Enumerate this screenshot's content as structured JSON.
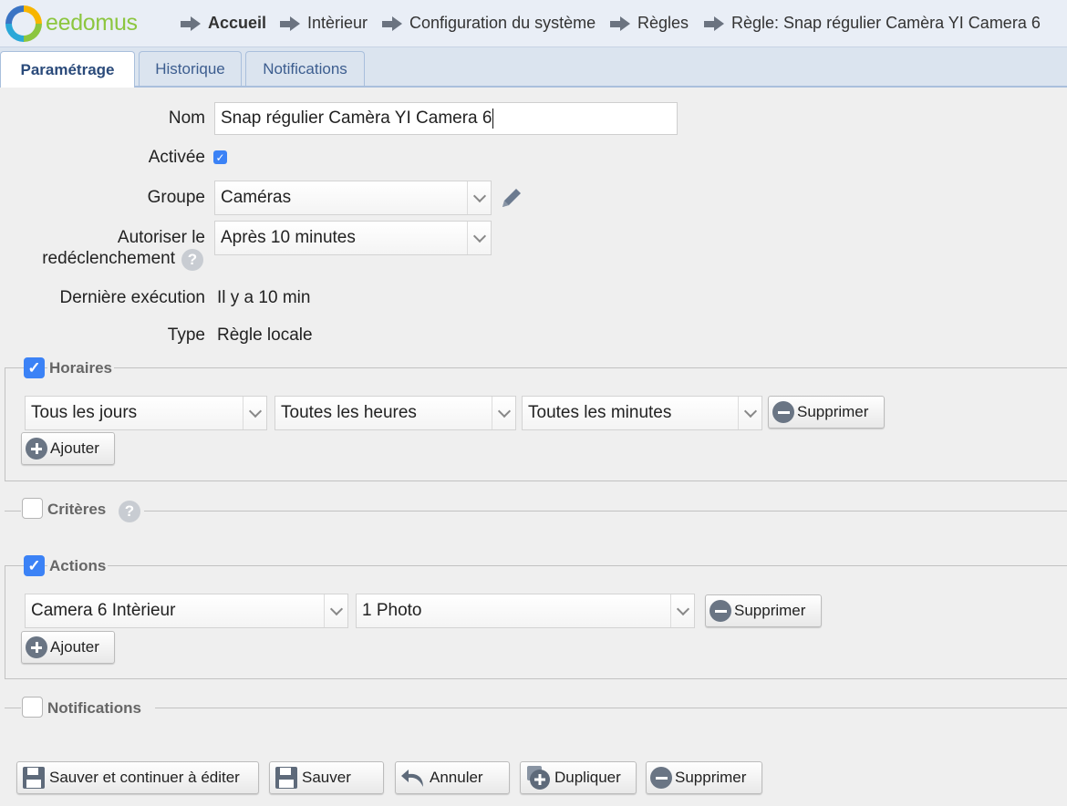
{
  "app": {
    "logo_text": "eedomus"
  },
  "breadcrumb": [
    "Accueil",
    "Intèrieur",
    "Configuration du système",
    "Règles",
    "Règle: Snap régulier Camèra YI Camera 6"
  ],
  "tabs": [
    {
      "label": "Paramétrage",
      "active": true
    },
    {
      "label": "Historique",
      "active": false
    },
    {
      "label": "Notifications",
      "active": false
    }
  ],
  "form": {
    "nom_label": "Nom",
    "nom_value": "Snap régulier Camèra YI Camera 6",
    "activee_label": "Activée",
    "activee_checked": true,
    "groupe_label": "Groupe",
    "groupe_value": "Caméras",
    "autoriser_label_1": "Autoriser le",
    "autoriser_label_2": "redéclenchement",
    "autoriser_value": "Après 10 minutes",
    "derniere_label": "Dernière exécution",
    "derniere_value": "Il y a 10 min",
    "type_label": "Type",
    "type_value": "Règle locale"
  },
  "horaires": {
    "legend": "Horaires",
    "checked": true,
    "jours": "Tous les jours",
    "heures": "Toutes les heures",
    "minutes": "Toutes les minutes",
    "supprimer": "Supprimer",
    "ajouter": "Ajouter"
  },
  "criteres": {
    "legend": "Critères",
    "checked": false
  },
  "actions": {
    "legend": "Actions",
    "checked": true,
    "device": "Camera 6 Intèrieur",
    "value": "1 Photo",
    "supprimer": "Supprimer",
    "ajouter": "Ajouter"
  },
  "notifications": {
    "legend": "Notifications",
    "checked": false
  },
  "buttons": {
    "save_continue": "Sauver et continuer à éditer",
    "save": "Sauver",
    "cancel": "Annuler",
    "duplicate": "Dupliquer",
    "delete": "Supprimer"
  },
  "colors": {
    "accent": "#3b82f6",
    "header_bg": "#e9eef6",
    "tab_text": "#3c5d8f"
  }
}
